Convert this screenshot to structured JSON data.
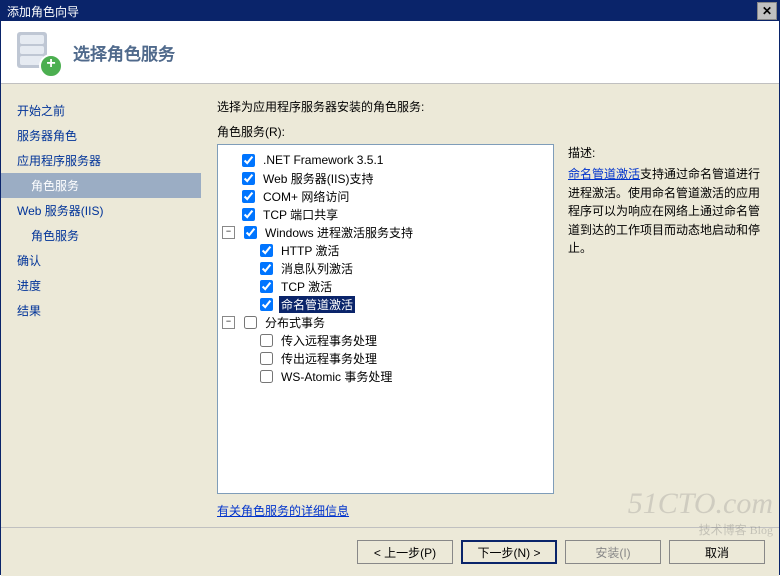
{
  "title": "添加角色向导",
  "header": {
    "title": "选择角色服务"
  },
  "sidebar": {
    "steps": [
      {
        "label": "开始之前"
      },
      {
        "label": "服务器角色"
      },
      {
        "label": "应用程序服务器"
      },
      {
        "label": "角色服务",
        "active": true,
        "indent": true
      },
      {
        "label": "Web 服务器(IIS)"
      },
      {
        "label": "角色服务",
        "indent": true
      },
      {
        "label": "确认"
      },
      {
        "label": "进度"
      },
      {
        "label": "结果"
      }
    ]
  },
  "content": {
    "instruction": "选择为应用程序服务器安装的角色服务:",
    "roles_label": "角色服务(R):",
    "tree": [
      {
        "label": ".NET Framework 3.5.1",
        "checked": true
      },
      {
        "label": "Web 服务器(IIS)支持",
        "checked": true
      },
      {
        "label": "COM+ 网络访问",
        "checked": true
      },
      {
        "label": "TCP 端口共享",
        "checked": true
      },
      {
        "label": "Windows 进程激活服务支持",
        "checked": true,
        "expanded": true,
        "children": [
          {
            "label": "HTTP 激活",
            "checked": true
          },
          {
            "label": "消息队列激活",
            "checked": true
          },
          {
            "label": "TCP 激活",
            "checked": true
          },
          {
            "label": "命名管道激活",
            "checked": true,
            "selected": true
          }
        ]
      },
      {
        "label": "分布式事务",
        "checked": false,
        "expanded": true,
        "children": [
          {
            "label": "传入远程事务处理",
            "checked": false
          },
          {
            "label": "传出远程事务处理",
            "checked": false
          },
          {
            "label": "WS-Atomic 事务处理",
            "checked": false
          }
        ]
      }
    ],
    "description": {
      "title": "描述:",
      "link": "命名管道激活",
      "text": "支持通过命名管道进行进程激活。使用命名管道激活的应用程序可以为响应在网络上通过命名管道到达的工作项目而动态地启动和停止。"
    },
    "more_link": "有关角色服务的详细信息"
  },
  "buttons": {
    "prev": "< 上一步(P)",
    "next": "下一步(N) >",
    "install": "安装(I)",
    "cancel": "取消"
  },
  "watermark": {
    "main": "51CTO.com",
    "sub": "技术博客  Blog"
  }
}
